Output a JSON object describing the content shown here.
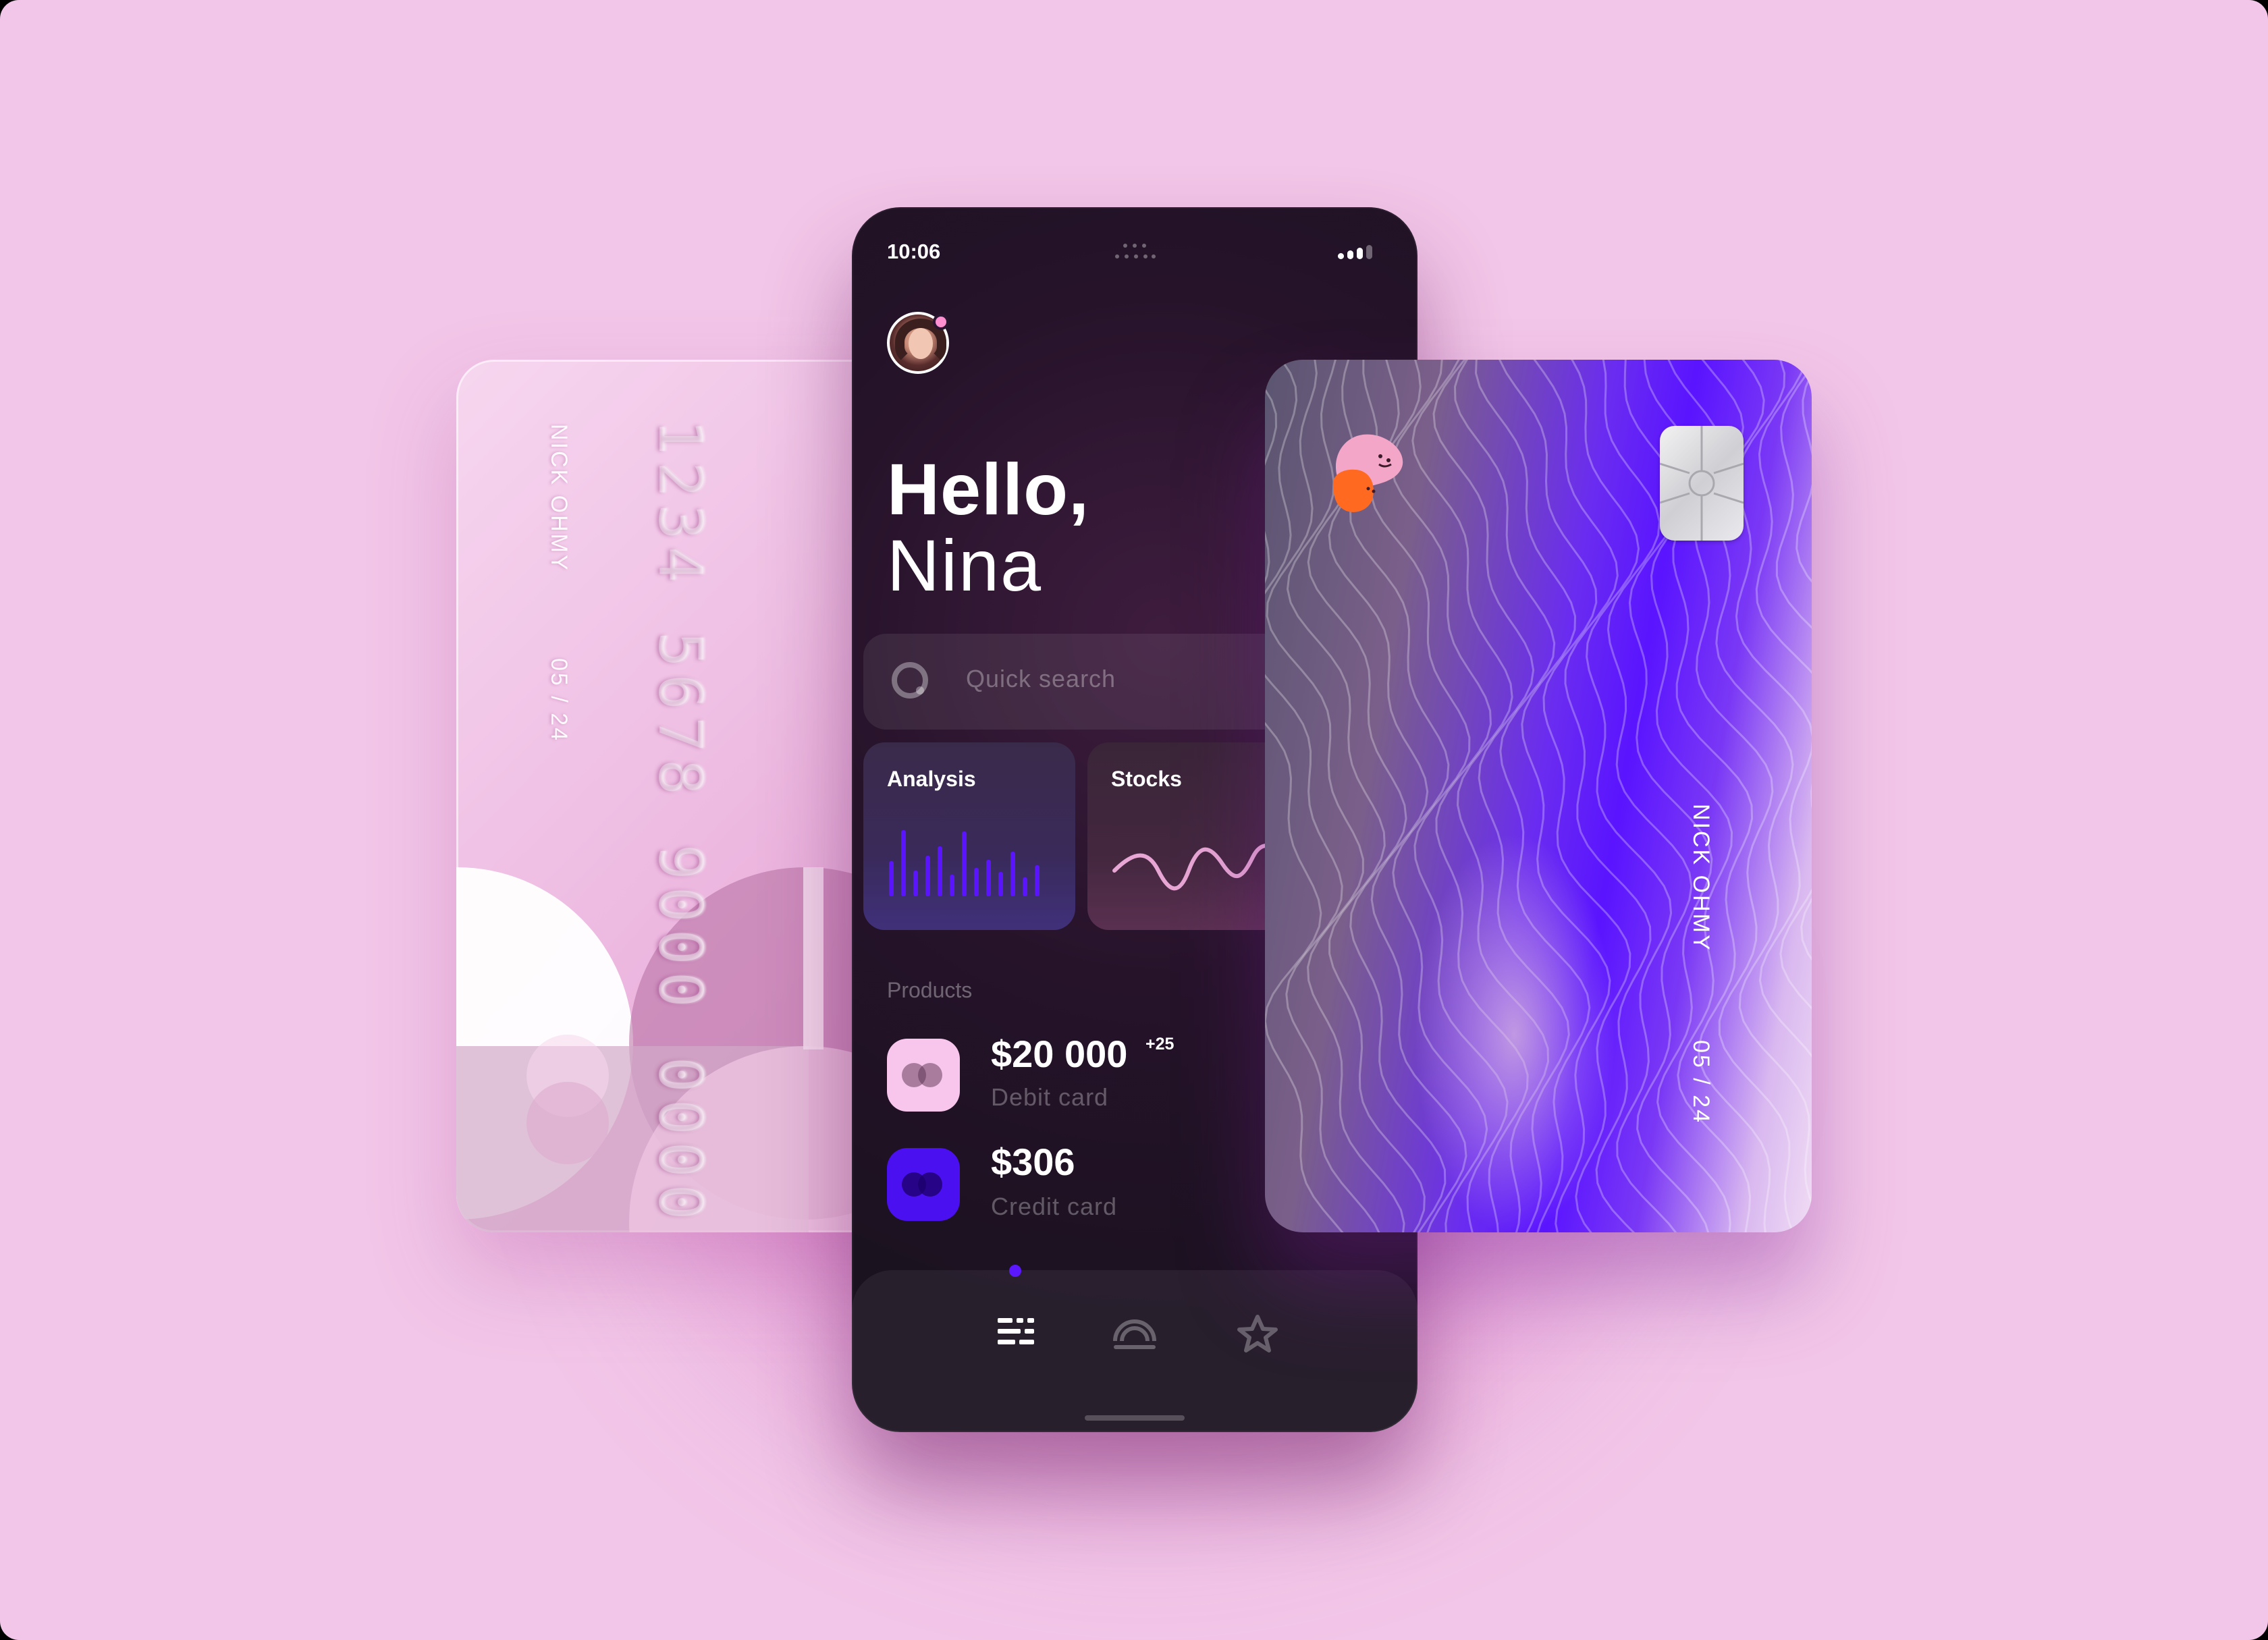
{
  "status_bar": {
    "time": "10:06"
  },
  "greeting": {
    "line1": "Hello,",
    "line2": "Nina"
  },
  "search": {
    "placeholder": "Quick search"
  },
  "tiles": [
    {
      "title": "Analysis"
    },
    {
      "title": "Stocks"
    }
  ],
  "products": {
    "label": "Products",
    "items": [
      {
        "amount": "$20 000",
        "badge": "+25",
        "subtitle": "Debit card"
      },
      {
        "amount": "$306",
        "subtitle": "Credit card"
      }
    ]
  },
  "tab_bar": {
    "tabs": [
      {
        "icon": "list-icon",
        "active": true
      },
      {
        "icon": "dashboard-gauge-icon",
        "active": false
      },
      {
        "icon": "star-icon",
        "active": false
      }
    ]
  },
  "card_left": {
    "holder": "NICK OHMY",
    "expiry": "05 / 24",
    "number": "1234 5678 9000 0000"
  },
  "card_right": {
    "holder": "NICK OHMY",
    "expiry": "05 / 24"
  },
  "colors": {
    "background": "#f2c6e8",
    "phone_bg": "#1b1220",
    "accent": "#5a14ff",
    "debit_icon": "#f8c6ec",
    "credit_icon": "#4a10f0"
  }
}
